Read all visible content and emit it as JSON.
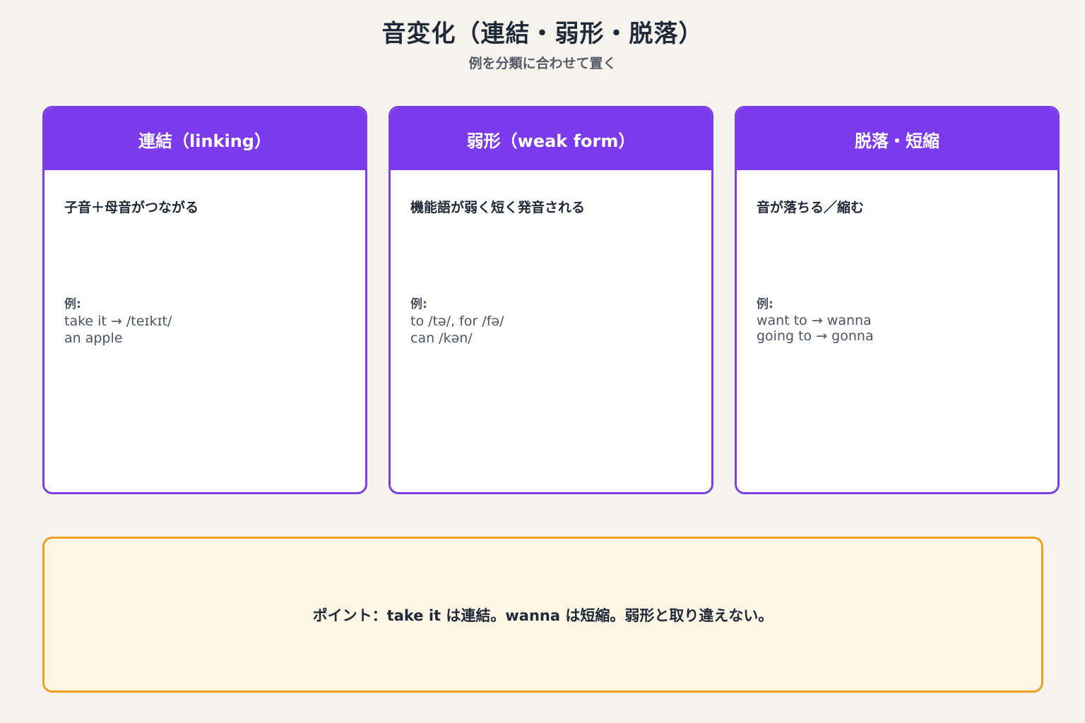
{
  "header": {
    "title": "音変化（連結・弱形・脱落）",
    "subtitle": "例を分類に合わせて置く"
  },
  "cards": [
    {
      "title": "連結（linking）",
      "description": "子音＋母音がつながる",
      "example_label": "例:",
      "examples": [
        "take it → /teɪkɪt/",
        "an apple"
      ]
    },
    {
      "title": "弱形（weak form）",
      "description": "機能語が弱く短く発音される",
      "example_label": "例:",
      "examples": [
        "to /tə/, for /fə/",
        "can /kən/"
      ]
    },
    {
      "title": "脱落・短縮",
      "description": "音が落ちる／縮む",
      "example_label": "例:",
      "examples": [
        "want to → wanna",
        "going to → gonna"
      ]
    }
  ],
  "note": {
    "text": "ポイント：take it は連結。wanna は短縮。弱形と取り違えない。"
  },
  "colors": {
    "accent": "#7c3aed",
    "note_border": "#f0a020",
    "note_bg": "#fdf6e5",
    "background": "#f6f3ee"
  }
}
